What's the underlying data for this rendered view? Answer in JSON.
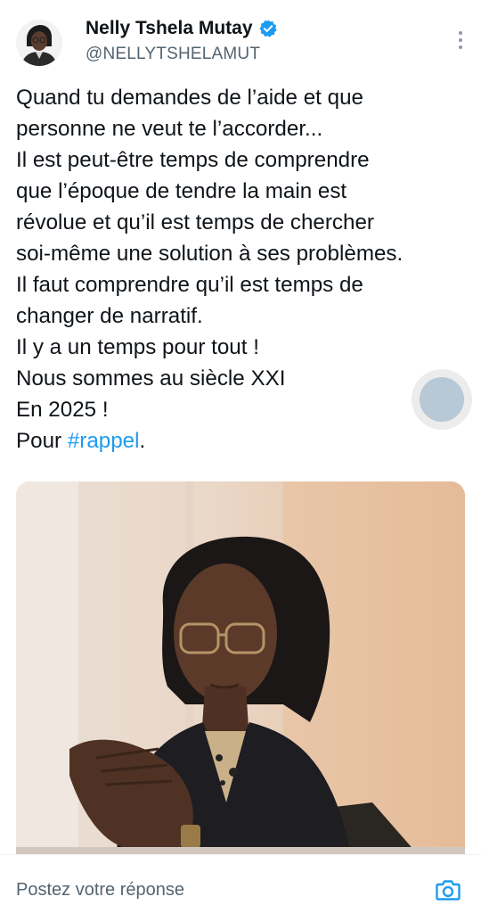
{
  "author": {
    "display_name": "Nelly Tshela Mutay",
    "handle": "@NELLYTSHELAMUT"
  },
  "tweet": {
    "lines": [
      "Quand tu demandes de l’aide et que",
      "personne ne veut te l’accorder...",
      "Il est peut-être temps de comprendre",
      "que l’époque de tendre la main est",
      "révolue et qu’il est temps de chercher",
      "soi-même une solution à ses problèmes.",
      "Il faut comprendre qu’il est temps de",
      "changer de narratif.",
      "Il y a un temps pour tout !",
      "Nous sommes au siècle XXI",
      "En 2025 !"
    ],
    "last_line_prefix": "Pour ",
    "hashtag": "#rappel",
    "last_line_suffix": "."
  },
  "reply": {
    "placeholder": "Postez votre réponse"
  },
  "icons": {
    "verified": "verified-badge-icon",
    "more": "more-vertical-icon",
    "camera": "camera-icon"
  },
  "colors": {
    "accent": "#1d9bf0",
    "text": "#0f1419",
    "secondary": "#536471"
  }
}
